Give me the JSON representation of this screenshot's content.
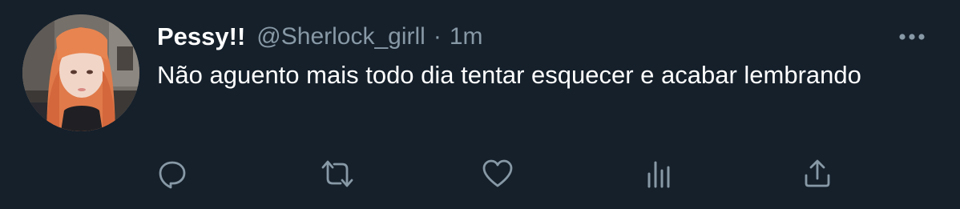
{
  "tweet": {
    "display_name": "Pessy!!",
    "handle": "@Sherlock_girll",
    "separator": "·",
    "time": "1m",
    "text": "Não aguento mais todo dia tentar esquecer e acabar lembrando"
  },
  "icons": {
    "more": "more-horizontal-icon",
    "reply": "reply-icon",
    "retweet": "retweet-icon",
    "like": "heart-icon",
    "analytics": "analytics-icon",
    "share": "share-icon"
  },
  "colors": {
    "background": "#15202b",
    "text_primary": "#ffffff",
    "text_secondary": "#8899a6",
    "icon": "#8899a6"
  }
}
